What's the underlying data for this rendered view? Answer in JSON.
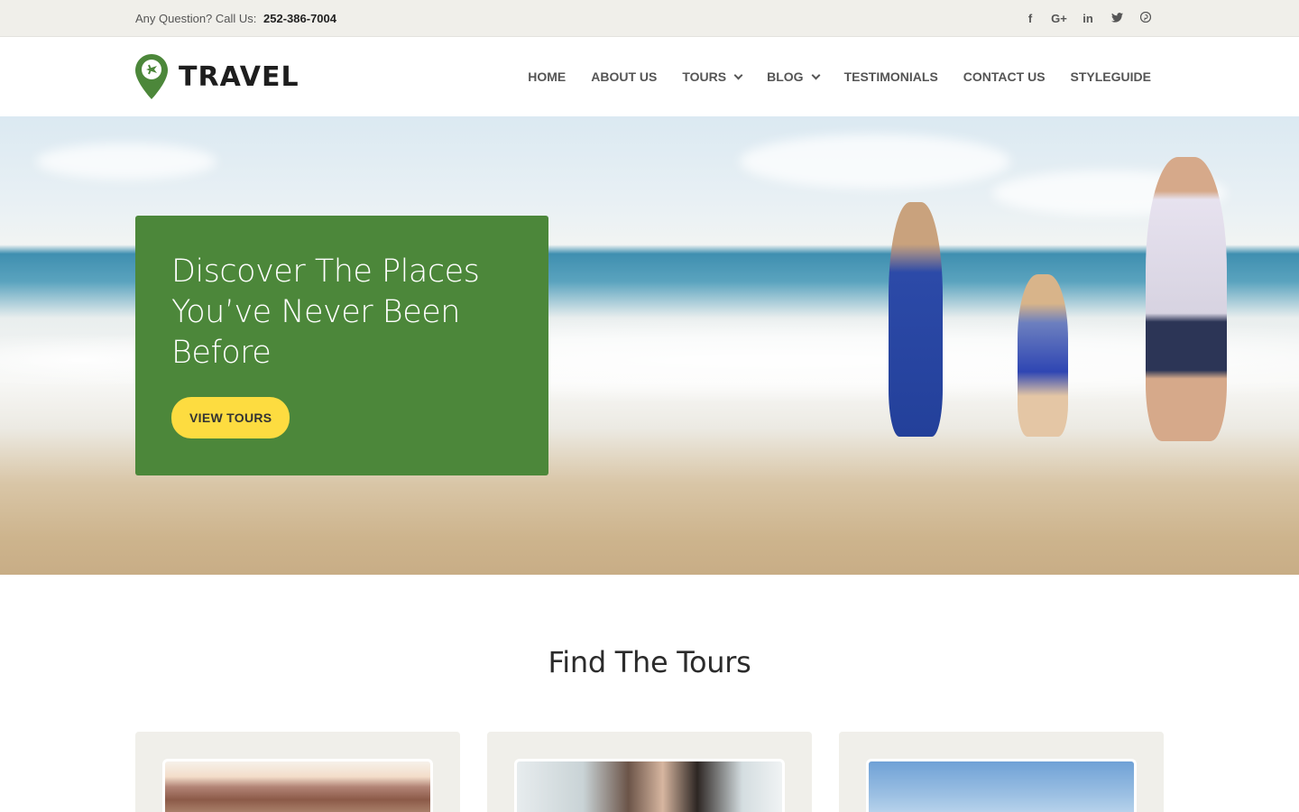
{
  "topbar": {
    "question": "Any Question? Call Us:",
    "phone": "252-386-7004",
    "social": [
      {
        "icon": "facebook-icon",
        "glyph": "f"
      },
      {
        "icon": "google-plus-icon",
        "glyph": "G+"
      },
      {
        "icon": "linkedin-icon",
        "glyph": "in"
      },
      {
        "icon": "twitter-icon",
        "glyph": "🐦"
      },
      {
        "icon": "pinterest-icon",
        "glyph": "℗"
      }
    ]
  },
  "header": {
    "logo_text": "TRAVEL",
    "nav": [
      {
        "label": "HOME"
      },
      {
        "label": "ABOUT US"
      },
      {
        "label": "TOURS"
      },
      {
        "label": "BLOG"
      },
      {
        "label": "TESTIMONIALS"
      },
      {
        "label": "CONTACT US"
      },
      {
        "label": "STYLEGUIDE"
      }
    ]
  },
  "hero": {
    "title": "Discover The Places You’ve Never Been Before",
    "button": "VIEW TOURS"
  },
  "tours": {
    "title": "Find The Tours"
  },
  "colors": {
    "brand_green": "#4c873a",
    "accent_yellow": "#fddc40",
    "topbar_bg": "#f0efea"
  }
}
